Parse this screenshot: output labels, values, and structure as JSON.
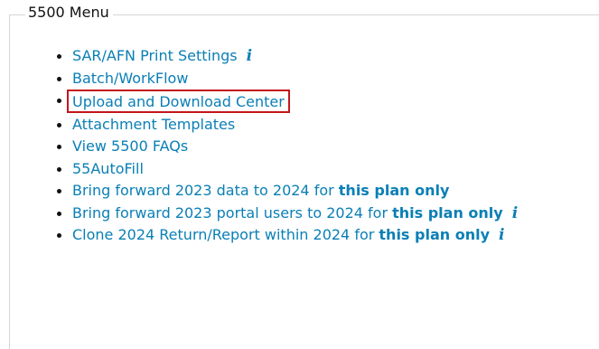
{
  "fieldset": {
    "legend": "5500 Menu"
  },
  "menu": {
    "items": [
      {
        "label": "SAR/AFN Print Settings",
        "info_icon": "info-icon"
      },
      {
        "label": "Batch/WorkFlow"
      },
      {
        "label": "Upload and Download Center",
        "highlighted": true
      },
      {
        "label": "Attachment Templates"
      },
      {
        "label": "View 5500 FAQs"
      },
      {
        "label": "55AutoFill"
      },
      {
        "label": "Bring forward 2023 data to 2024 for ",
        "bold": "this plan only"
      },
      {
        "label": "Bring forward 2023 portal users to 2024 for ",
        "bold": "this plan only",
        "info_icon": "info-icon"
      },
      {
        "label": "Clone 2024 Return/Report within 2024 for ",
        "bold": "this plan only",
        "info_icon": "info-icon"
      }
    ]
  },
  "icons": {
    "info_glyph": "i"
  },
  "colors": {
    "link": "#0a7fb5",
    "highlight_border": "#c4161c",
    "legend_text": "#111111"
  }
}
